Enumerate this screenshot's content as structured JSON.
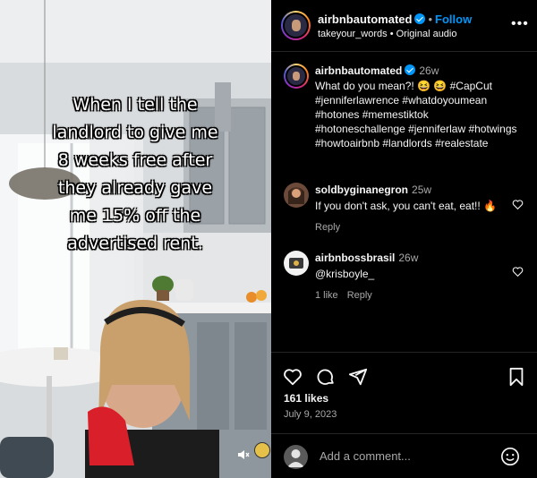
{
  "post": {
    "author": "airbnbautomated",
    "follow_label": "Follow",
    "separator": "•",
    "audio_line": "takeyour_words • Original audio",
    "more_label": "•••"
  },
  "media": {
    "caption": "When I tell the\nlandlord to give me\n8 weeks free after\nthey already gave\nme 15% off the\nadvertised rent."
  },
  "caption_comment": {
    "user": "airbnbautomated",
    "time": "26w",
    "text": "What do you mean?! 😆 😆 #CapCut #jenniferlawrence #whatdoyoumean #hotones #memestiktok #hotoneschallenge #jenniferlaw #hotwings #howtoairbnb #landlords #realestate"
  },
  "comments": [
    {
      "user": "soldbyginanegron",
      "time": "25w",
      "text": "If you don't ask, you can't eat, eat!! 🔥",
      "reply_label": "Reply",
      "likes_label": ""
    },
    {
      "user": "airbnbossbrasil",
      "time": "26w",
      "text": "@krisboyle_",
      "likes_label": "1 like",
      "reply_label": "Reply"
    }
  ],
  "stats": {
    "likes": "161 likes",
    "date": "July 9, 2023"
  },
  "add_comment": {
    "placeholder": "Add a comment..."
  },
  "icons": {
    "like": "heart-icon",
    "comment": "comment-icon",
    "share": "share-icon",
    "save": "bookmark-icon",
    "emoji": "emoji-icon",
    "mute": "muted-speaker-icon"
  },
  "colors": {
    "background": "#000000",
    "text": "#f5f5f5",
    "muted": "#a8a8a8",
    "link": "#0095f6",
    "divider": "#262626"
  }
}
